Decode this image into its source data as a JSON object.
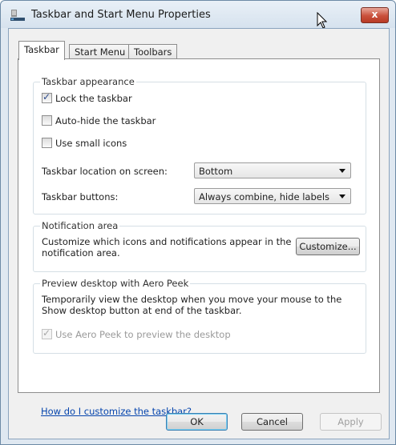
{
  "window": {
    "title": "Taskbar and Start Menu Properties",
    "close_label": "x"
  },
  "tabs": [
    {
      "label": "Taskbar",
      "active": true
    },
    {
      "label": "Start Menu",
      "active": false
    },
    {
      "label": "Toolbars",
      "active": false
    }
  ],
  "appearance": {
    "title": "Taskbar appearance",
    "lock": {
      "label": "Lock the taskbar",
      "checked": true
    },
    "autohide": {
      "label": "Auto-hide the taskbar",
      "checked": false
    },
    "small_icons": {
      "label": "Use small icons",
      "checked": false
    },
    "location": {
      "label": "Taskbar location on screen:",
      "value": "Bottom"
    },
    "buttons": {
      "label": "Taskbar buttons:",
      "value": "Always combine, hide labels"
    }
  },
  "notification": {
    "title": "Notification area",
    "description": "Customize which icons and notifications appear in the notification area.",
    "customize_label": "Customize..."
  },
  "peek": {
    "title": "Preview desktop with Aero Peek",
    "description": "Temporarily view the desktop when you move your mouse to the Show desktop button at end of the taskbar.",
    "checkbox": {
      "label": "Use Aero Peek to preview the desktop",
      "checked": true,
      "disabled": true
    }
  },
  "help_link": "How do I customize the taskbar?",
  "footer": {
    "ok": "OK",
    "cancel": "Cancel",
    "apply": "Apply"
  },
  "icons": {
    "app": "taskbar-app-icon",
    "close": "close-icon",
    "checkmark": "checkmark-icon",
    "dropdown": "chevron-down-icon",
    "cursor": "mouse-pointer-icon"
  }
}
